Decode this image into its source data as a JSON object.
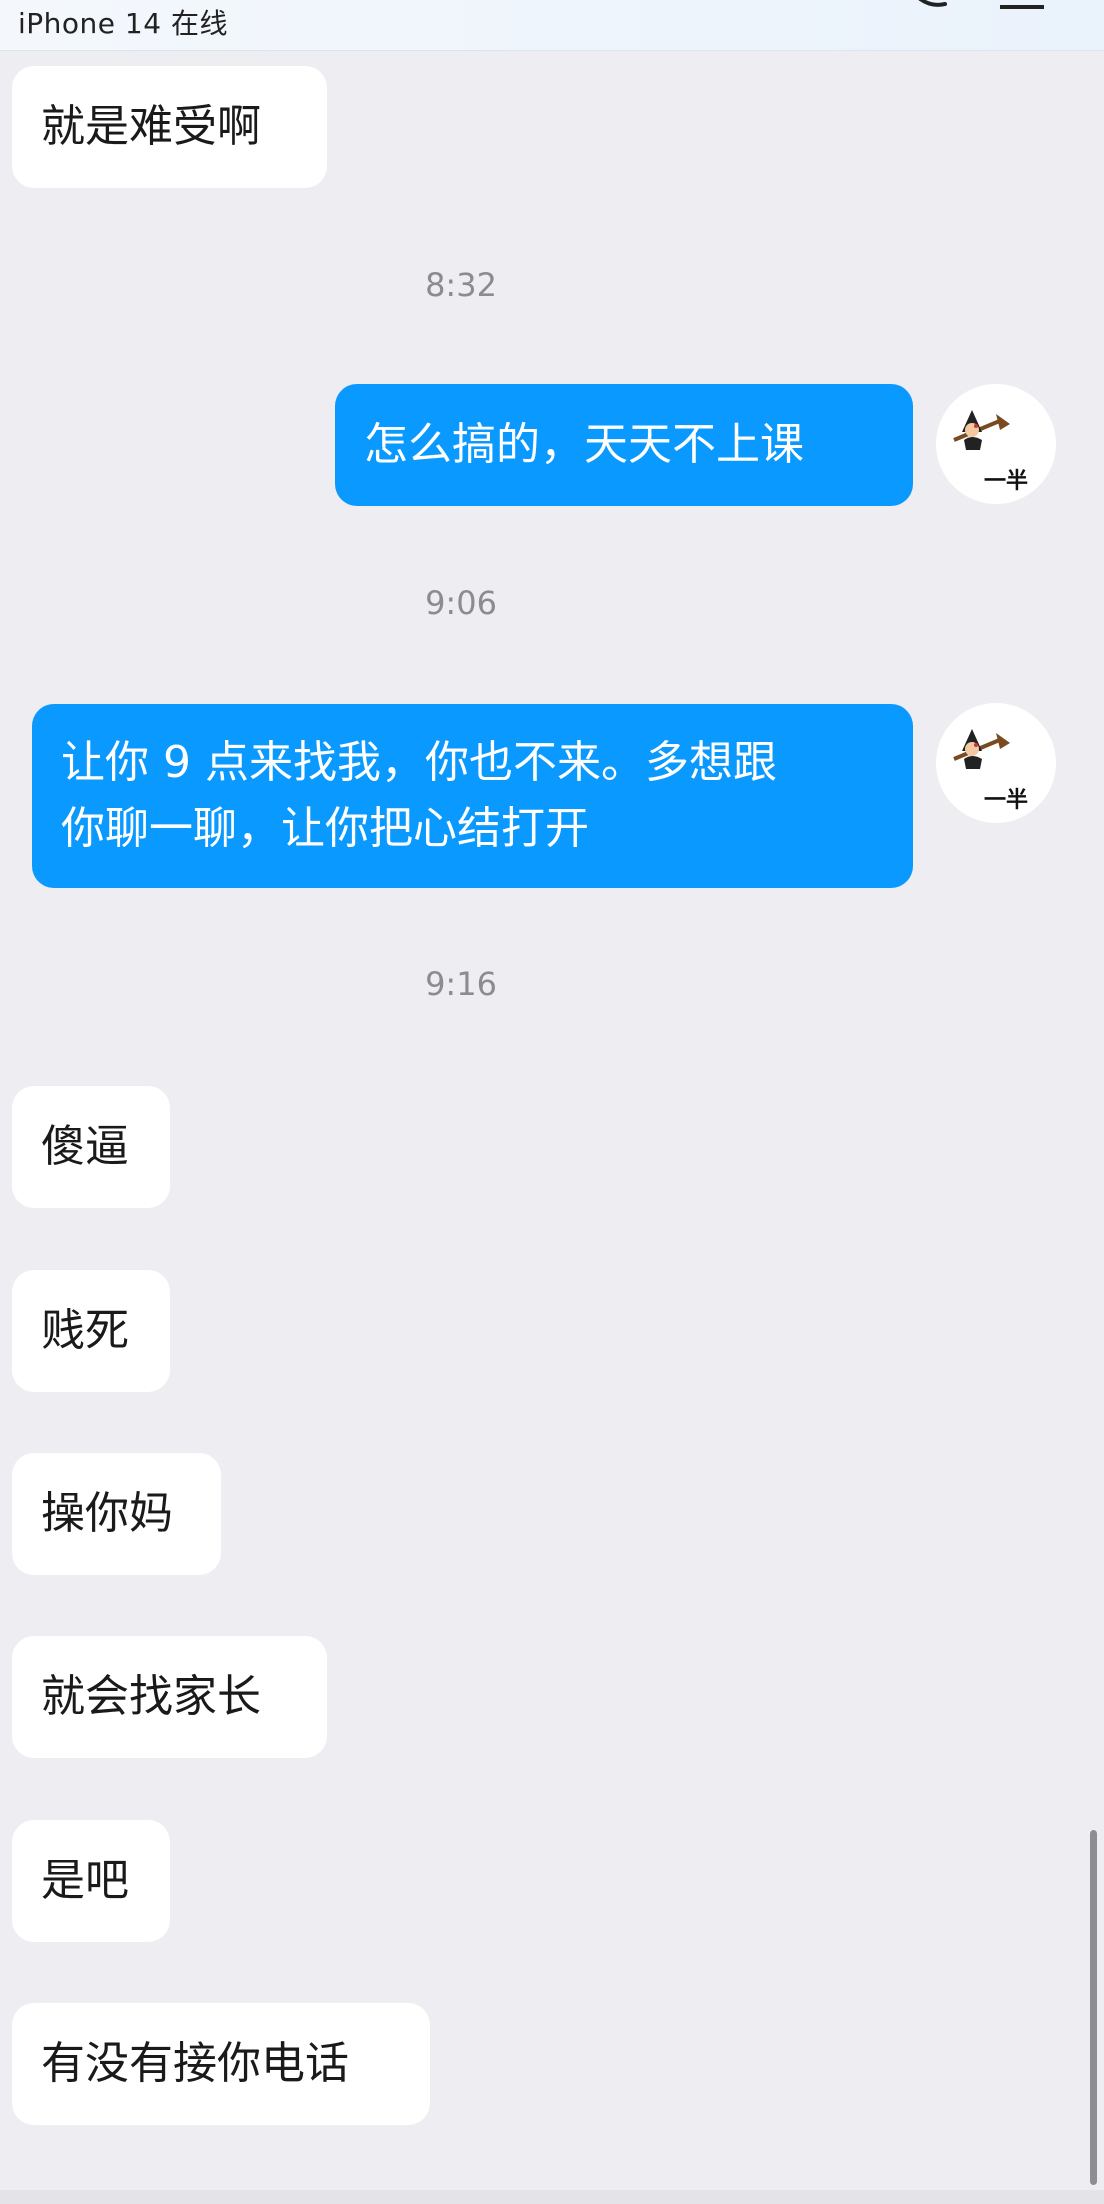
{
  "header": {
    "status_text": "iPhone 14 在线",
    "phone_icon": "phone-icon",
    "menu_icon": "menu-icon"
  },
  "conversation": {
    "avatar_label": "一半",
    "items": [
      {
        "kind": "incoming",
        "text": "就是难受啊"
      },
      {
        "kind": "timestamp",
        "text": "8:32"
      },
      {
        "kind": "outgoing",
        "text": "怎么搞的，天天不上课"
      },
      {
        "kind": "timestamp",
        "text": "9:06"
      },
      {
        "kind": "outgoing",
        "lines": [
          "让你 9 点来找我，你也不来。多想跟",
          "你聊一聊，让你把心结打开"
        ]
      },
      {
        "kind": "timestamp",
        "text": "9:16"
      },
      {
        "kind": "incoming",
        "text": "傻逼"
      },
      {
        "kind": "incoming",
        "text": "贱死"
      },
      {
        "kind": "incoming",
        "text": "操你妈"
      },
      {
        "kind": "incoming",
        "text": "就会找家长"
      },
      {
        "kind": "incoming",
        "text": "是吧"
      },
      {
        "kind": "incoming",
        "text": "有没有接你电话"
      }
    ]
  },
  "colors": {
    "background": "#ededf2",
    "outgoing_bubble": "#0a99ff",
    "incoming_bubble": "#ffffff",
    "timestamp_text": "#8c8c90"
  }
}
